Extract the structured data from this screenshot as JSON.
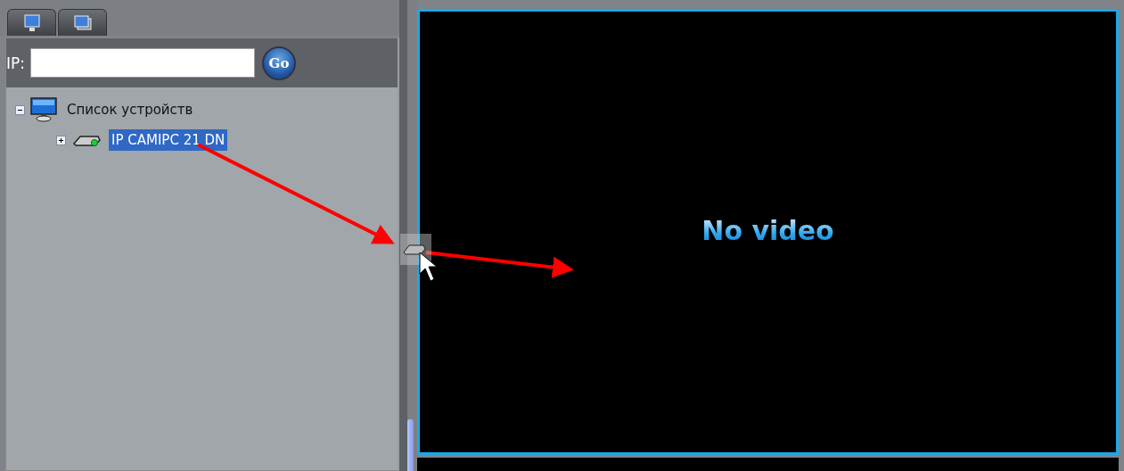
{
  "ip_bar": {
    "label": "IP:",
    "button": "Go"
  },
  "tree": [
    {
      "label": "Список устройств",
      "kind": "group",
      "expanded": true,
      "selected": false,
      "children": [
        {
          "label": "IP CAMIPC 21 DN",
          "kind": "camera",
          "expanded": false,
          "selected": true
        }
      ]
    }
  ],
  "video": {
    "message": "No video"
  }
}
